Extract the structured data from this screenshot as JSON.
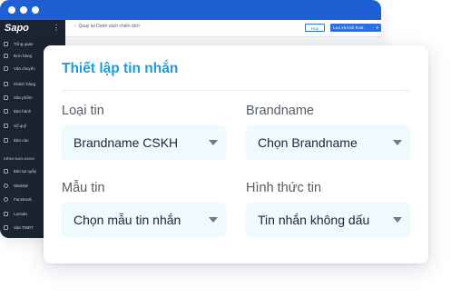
{
  "window": {
    "logo": "Sapo",
    "sidebar_items": [
      {
        "label": "Tổng quan",
        "icon": "home-icon"
      },
      {
        "label": "Đơn hàng",
        "icon": "order-icon"
      },
      {
        "label": "Vận chuyển",
        "icon": "truck-icon"
      },
      {
        "label": "Khách hàng",
        "icon": "user-icon"
      },
      {
        "label": "Sản phẩm",
        "icon": "box-icon"
      },
      {
        "label": "Báo hành",
        "icon": "shield-icon"
      },
      {
        "label": "Sổ quỹ",
        "icon": "wallet-icon"
      },
      {
        "label": "Báo cáo",
        "icon": "chart-icon"
      }
    ],
    "channels_section": "KÊNH BÁN HÀNG",
    "channel_items": [
      {
        "label": "Bán tại quầy",
        "icon": "pos-icon"
      },
      {
        "label": "Website",
        "icon": "globe-icon"
      },
      {
        "label": "Facebook",
        "icon": "facebook-icon"
      },
      {
        "label": "Lazada",
        "icon": "lazada-icon"
      },
      {
        "label": "Sàn TMĐT",
        "icon": "cart-icon"
      }
    ],
    "back_link": "Quay lại Danh sách chiến dịch",
    "cancel_button": "Hủy",
    "save_button": "Lưu và kích hoạt"
  },
  "card": {
    "title": "Thiết lập tin nhắn",
    "fields": {
      "message_type": {
        "label": "Loại tin",
        "value": "Brandname CSKH"
      },
      "brandname": {
        "label": "Brandname",
        "value": "Chọn Brandname"
      },
      "template": {
        "label": "Mẫu tin",
        "value": "Chọn mẫu tin nhắn"
      },
      "format": {
        "label": "Hình thức tin",
        "value": "Tin nhắn không dấu"
      }
    }
  },
  "colors": {
    "window_bar": "#1f5fd4",
    "sidebar": "#1c2431",
    "title": "#1c9bd8",
    "select_bg": "#eefafd",
    "primary_button": "#2f6fe4"
  }
}
